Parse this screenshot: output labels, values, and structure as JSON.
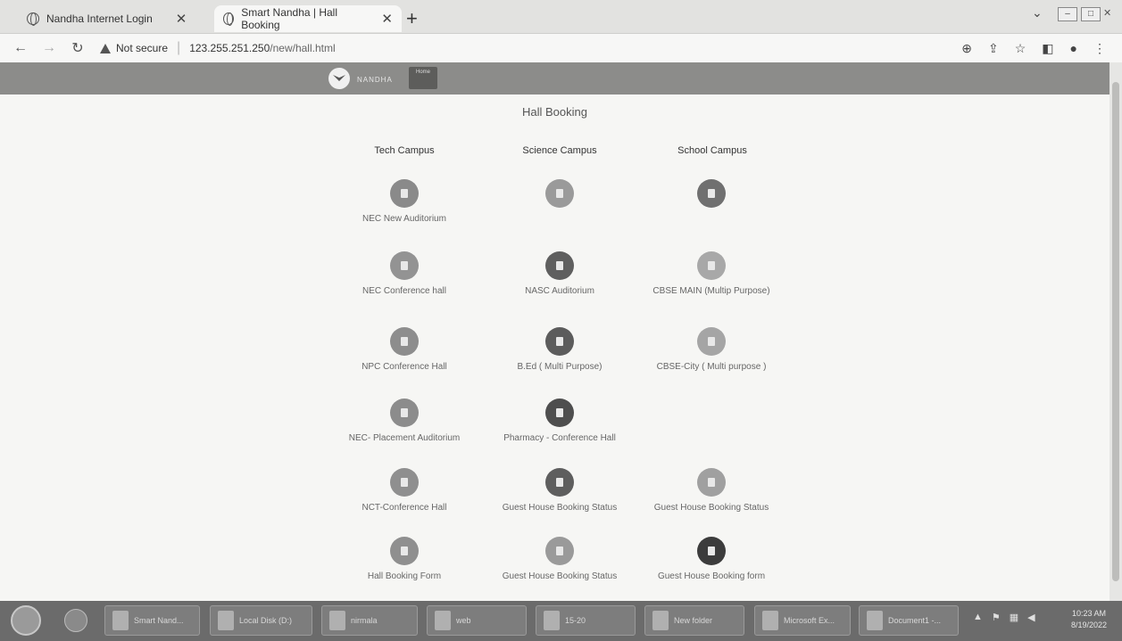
{
  "browser": {
    "tabs": [
      {
        "title": "Nandha Internet Login",
        "active": false
      },
      {
        "title": "Smart Nandha | Hall Booking",
        "active": true
      }
    ],
    "security_label": "Not secure",
    "url_host": "123.255.251.250",
    "url_path": "/new/hall.html"
  },
  "site": {
    "brand": "NANDHA",
    "home_label": "Home",
    "page_title": "Hall Booking"
  },
  "campuses": [
    {
      "name": "Tech Campus",
      "halls": [
        {
          "label": "NEC New Auditorium",
          "color": "#8a8a8a"
        },
        {
          "label": "NEC Conference hall",
          "color": "#939393"
        },
        {
          "label": "NPC Conference Hall",
          "color": "#8d8d8d"
        },
        {
          "label": "NEC- Placement Auditorium",
          "color": "#8c8c8c"
        },
        {
          "label": "NCT-Conference Hall",
          "color": "#8f8f8f"
        },
        {
          "label": "Hall Booking Form",
          "color": "#8f8f8f"
        }
      ]
    },
    {
      "name": "Science Campus",
      "halls": [
        {
          "label": "",
          "color": "#9a9a9a"
        },
        {
          "label": "NASC Auditorium",
          "color": "#5f5f5f"
        },
        {
          "label": "B.Ed ( Multi Purpose)",
          "color": "#5c5c5c"
        },
        {
          "label": "Pharmacy - Conference Hall",
          "color": "#4e4e4e"
        },
        {
          "label": "Guest House Booking Status",
          "color": "#5e5e5e"
        },
        {
          "label": "Guest House Booking Status",
          "color": "#9a9a9a"
        }
      ]
    },
    {
      "name": "School Campus",
      "halls": [
        {
          "label": "",
          "color": "#707070"
        },
        {
          "label": "CBSE MAIN (Multip Purpose)",
          "color": "#a8a8a8"
        },
        {
          "label": "CBSE-City ( Multi purpose )",
          "color": "#a5a5a5"
        },
        null,
        {
          "label": "Guest House Booking Status",
          "color": "#a0a0a0"
        },
        {
          "label": "Guest House Booking form",
          "color": "#3c3c3c"
        }
      ]
    }
  ],
  "taskbar": {
    "items": [
      "Smart Nand...",
      "Local Disk (D:)",
      "nirmala",
      "web",
      "15-20",
      "New folder",
      "Microsoft Ex...",
      "Document1 -..."
    ],
    "clock_time": "10:23 AM",
    "clock_date": "8/19/2022"
  }
}
